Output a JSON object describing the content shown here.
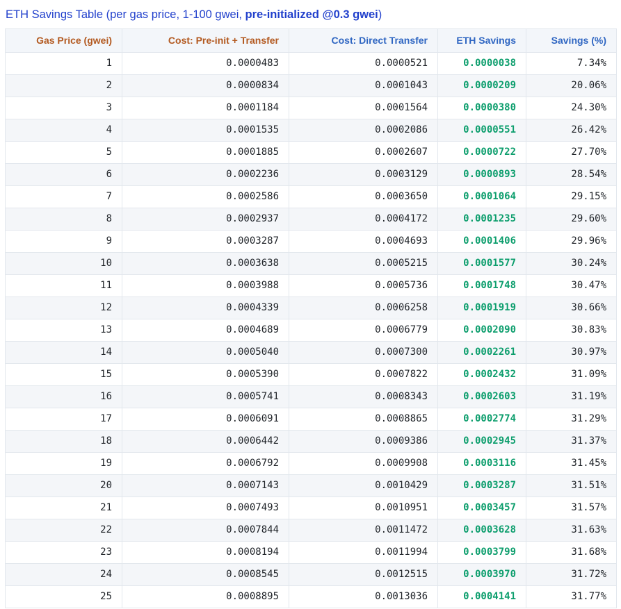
{
  "title": {
    "prefix": "ETH Savings Table (per gas price, 1-100 gwei, ",
    "bold": "pre-initialized @0.3 gwei",
    "suffix": ")"
  },
  "colors": {
    "title_blue": "#2140cc",
    "header_orange": "#b35a21",
    "header_blue": "#2f66c2",
    "savings_green": "#0d9e6d",
    "text_ink": "#1f2328",
    "row_stripe": "#f4f6f9",
    "header_background": "#f3f6fa",
    "border": "#e2e7ed"
  },
  "chart_data": {
    "type": "table",
    "title": "ETH Savings Table (per gas price, 1-100 gwei, pre-initialized @0.3 gwei)",
    "columns": [
      "Gas Price (gwei)",
      "Cost: Pre-init + Transfer",
      "Cost: Direct Transfer",
      "ETH Savings",
      "Savings (%)"
    ],
    "header_colors": [
      "orange",
      "orange",
      "blue",
      "blue",
      "blue"
    ],
    "rows": [
      [
        "1",
        "0.0000483",
        "0.0000521",
        "0.0000038",
        "7.34%"
      ],
      [
        "2",
        "0.0000834",
        "0.0001043",
        "0.0000209",
        "20.06%"
      ],
      [
        "3",
        "0.0001184",
        "0.0001564",
        "0.0000380",
        "24.30%"
      ],
      [
        "4",
        "0.0001535",
        "0.0002086",
        "0.0000551",
        "26.42%"
      ],
      [
        "5",
        "0.0001885",
        "0.0002607",
        "0.0000722",
        "27.70%"
      ],
      [
        "6",
        "0.0002236",
        "0.0003129",
        "0.0000893",
        "28.54%"
      ],
      [
        "7",
        "0.0002586",
        "0.0003650",
        "0.0001064",
        "29.15%"
      ],
      [
        "8",
        "0.0002937",
        "0.0004172",
        "0.0001235",
        "29.60%"
      ],
      [
        "9",
        "0.0003287",
        "0.0004693",
        "0.0001406",
        "29.96%"
      ],
      [
        "10",
        "0.0003638",
        "0.0005215",
        "0.0001577",
        "30.24%"
      ],
      [
        "11",
        "0.0003988",
        "0.0005736",
        "0.0001748",
        "30.47%"
      ],
      [
        "12",
        "0.0004339",
        "0.0006258",
        "0.0001919",
        "30.66%"
      ],
      [
        "13",
        "0.0004689",
        "0.0006779",
        "0.0002090",
        "30.83%"
      ],
      [
        "14",
        "0.0005040",
        "0.0007300",
        "0.0002261",
        "30.97%"
      ],
      [
        "15",
        "0.0005390",
        "0.0007822",
        "0.0002432",
        "31.09%"
      ],
      [
        "16",
        "0.0005741",
        "0.0008343",
        "0.0002603",
        "31.19%"
      ],
      [
        "17",
        "0.0006091",
        "0.0008865",
        "0.0002774",
        "31.29%"
      ],
      [
        "18",
        "0.0006442",
        "0.0009386",
        "0.0002945",
        "31.37%"
      ],
      [
        "19",
        "0.0006792",
        "0.0009908",
        "0.0003116",
        "31.45%"
      ],
      [
        "20",
        "0.0007143",
        "0.0010429",
        "0.0003287",
        "31.51%"
      ],
      [
        "21",
        "0.0007493",
        "0.0010951",
        "0.0003457",
        "31.57%"
      ],
      [
        "22",
        "0.0007844",
        "0.0011472",
        "0.0003628",
        "31.63%"
      ],
      [
        "23",
        "0.0008194",
        "0.0011994",
        "0.0003799",
        "31.68%"
      ],
      [
        "24",
        "0.0008545",
        "0.0012515",
        "0.0003970",
        "31.72%"
      ],
      [
        "25",
        "0.0008895",
        "0.0013036",
        "0.0004141",
        "31.77%"
      ]
    ]
  }
}
